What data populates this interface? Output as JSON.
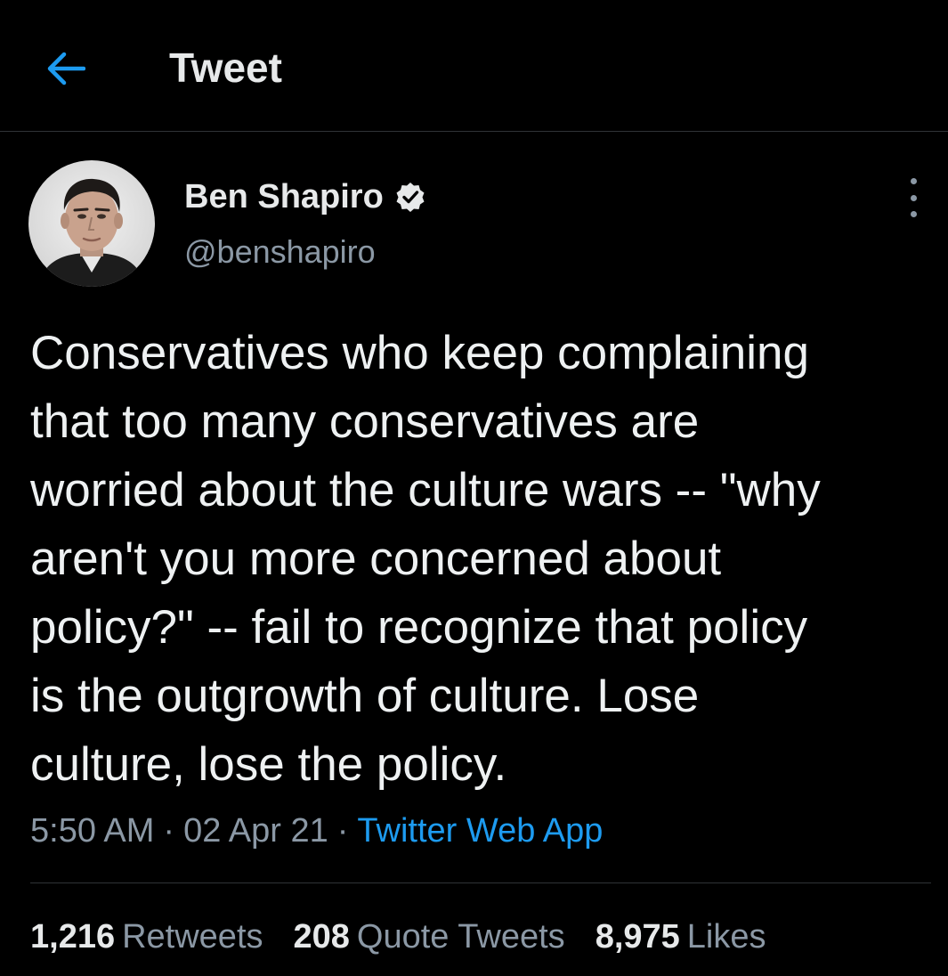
{
  "header": {
    "title": "Tweet",
    "back_icon": "arrow-left-icon",
    "accent_color": "#1d9bf0"
  },
  "author": {
    "display_name": "Ben Shapiro",
    "handle": "@benshapiro",
    "verified_icon": "verified-badge-icon",
    "avatar": "profile-photo"
  },
  "more_icon": "more-vertical-icon",
  "tweet": {
    "text": "Conservatives who keep complaining that too many conservatives are worried about the culture wars -- \"why aren't you more concerned about policy?\" -- fail to recognize that policy is the outgrowth of culture. Lose culture, lose the policy.",
    "lines": [
      "Conservatives who keep complaining",
      "that too many conservatives are",
      "worried about the culture wars -- \"why",
      "aren't you more concerned about",
      "policy?\" -- fail to recognize that policy",
      "is the outgrowth of culture. Lose",
      "culture, lose the policy."
    ],
    "time": "5:50 AM",
    "date": "02 Apr 21",
    "source": "Twitter Web App",
    "separator": "·"
  },
  "stats": {
    "retweets_count": "1,216",
    "retweets_label": "Retweets",
    "quotes_count": "208",
    "quotes_label": "Quote Tweets",
    "likes_count": "8,975",
    "likes_label": "Likes"
  }
}
